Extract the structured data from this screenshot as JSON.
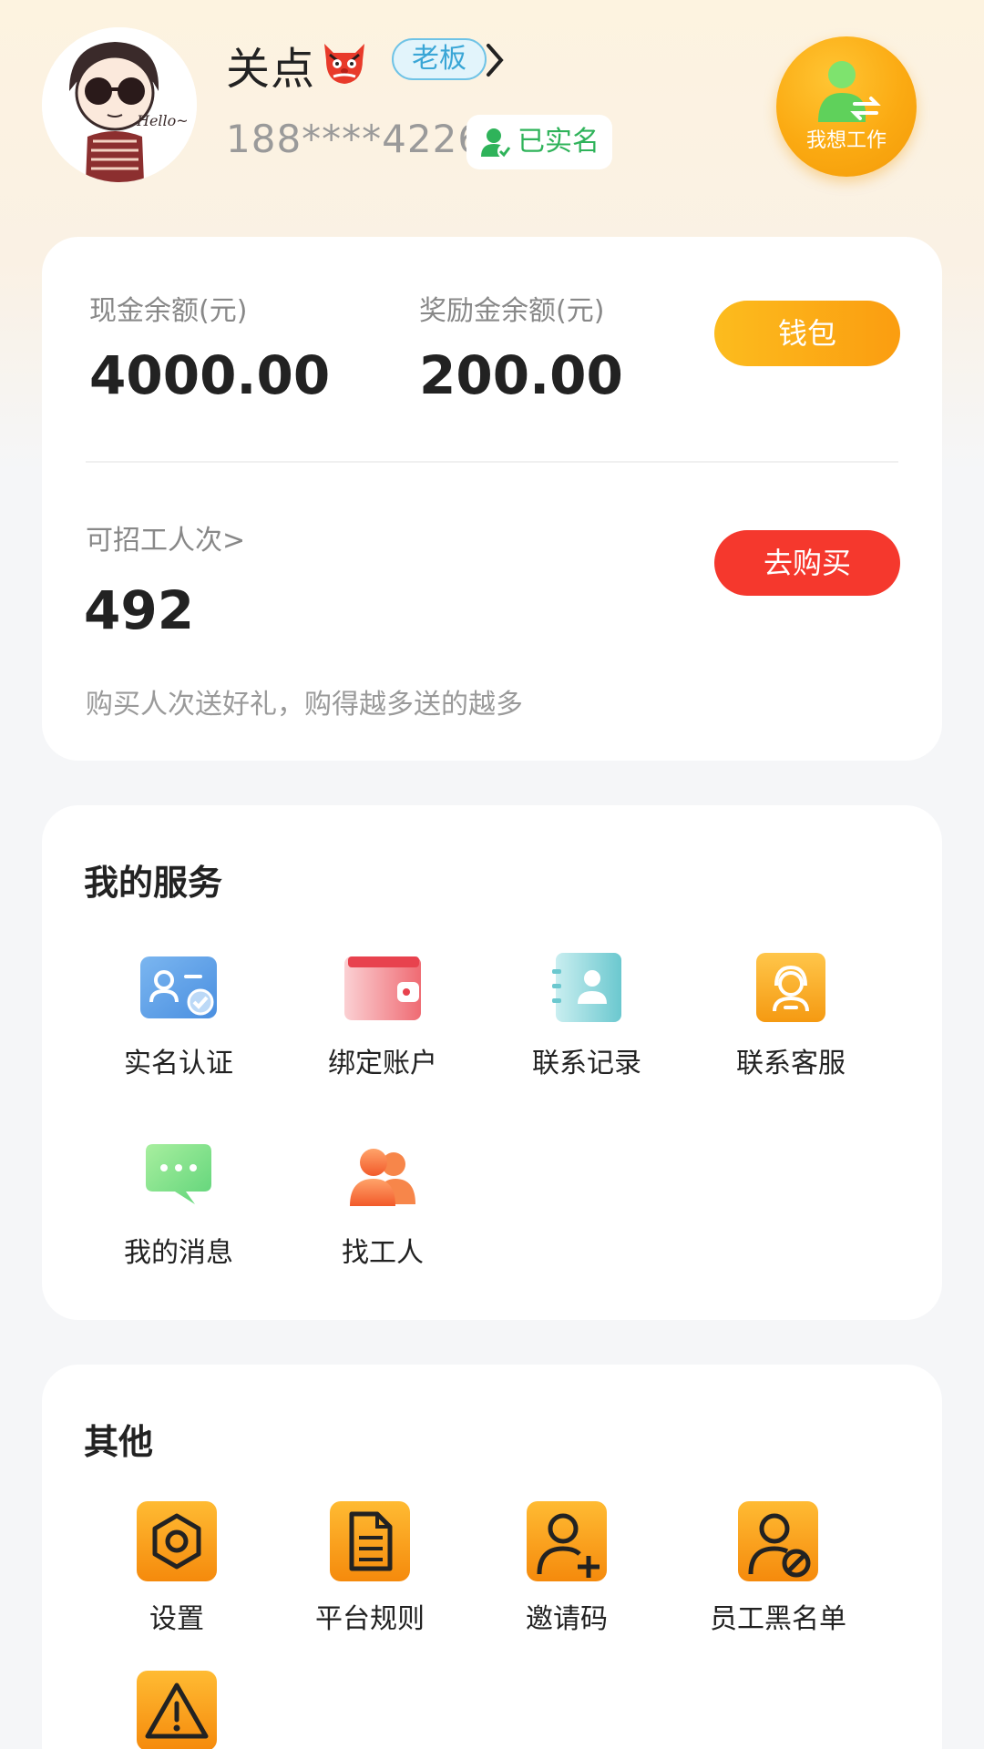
{
  "profile": {
    "name": "关点",
    "role_badge": "老板",
    "phone": "188****4226",
    "verified_label": "已实名",
    "switch_label": "我想工作",
    "avatar_text": "Hello~"
  },
  "balance": {
    "cash_label": "现金余额(元)",
    "cash_value": "4000.00",
    "bonus_label": "奖励金余额(元)",
    "bonus_value": "200.00",
    "wallet_button": "钱包",
    "hire_label": "可招工人次>",
    "hire_value": "492",
    "buy_button": "去购买",
    "promo_text": "购买人次送好礼，购得越多送的越多"
  },
  "services": {
    "title": "我的服务",
    "items": [
      {
        "label": "实名认证",
        "icon": "id-card-icon"
      },
      {
        "label": "绑定账户",
        "icon": "wallet-icon"
      },
      {
        "label": "联系记录",
        "icon": "contact-record-icon"
      },
      {
        "label": "联系客服",
        "icon": "customer-service-icon"
      },
      {
        "label": "我的消息",
        "icon": "message-icon"
      },
      {
        "label": "找工人",
        "icon": "find-worker-icon"
      }
    ]
  },
  "other": {
    "title": "其他",
    "items": [
      {
        "label": "设置",
        "icon": "settings-icon"
      },
      {
        "label": "平台规则",
        "icon": "document-icon"
      },
      {
        "label": "邀请码",
        "icon": "invite-user-icon"
      },
      {
        "label": "员工黑名单",
        "icon": "blacklist-user-icon"
      },
      {
        "label": "",
        "icon": "warning-icon"
      }
    ]
  },
  "colors": {
    "accent_orange": "#fba312",
    "buy_red": "#f5382d",
    "verified_green": "#2fb35a",
    "role_blue": "#3aa6d6"
  }
}
